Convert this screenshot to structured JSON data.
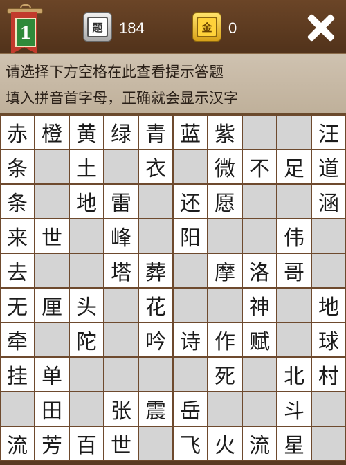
{
  "header": {
    "level_number": "1",
    "question_icon_char": "题",
    "question_count": "184",
    "gold_icon_char": "金",
    "gold_count": "0",
    "close_icon": "close-icon"
  },
  "hint": {
    "line1": "请选择下方空格在此查看提示答题",
    "line2": "填入拼音首字母，正确就会显示汉字"
  },
  "grid": {
    "rows": [
      [
        {
          "t": "赤",
          "s": "f"
        },
        {
          "t": "橙",
          "s": "f"
        },
        {
          "t": "黄",
          "s": "f"
        },
        {
          "t": "绿",
          "s": "f"
        },
        {
          "t": "青",
          "s": "f"
        },
        {
          "t": "蓝",
          "s": "f"
        },
        {
          "t": "紫",
          "s": "f"
        },
        {
          "t": "",
          "s": "b"
        },
        {
          "t": "",
          "s": "b"
        },
        {
          "t": "汪",
          "s": "f"
        }
      ],
      [
        {
          "t": "条",
          "s": "f"
        },
        {
          "t": "",
          "s": "b"
        },
        {
          "t": "土",
          "s": "f"
        },
        {
          "t": "",
          "s": "b"
        },
        {
          "t": "衣",
          "s": "f"
        },
        {
          "t": "",
          "s": "b"
        },
        {
          "t": "微",
          "s": "f"
        },
        {
          "t": "不",
          "s": "f"
        },
        {
          "t": "足",
          "s": "f"
        },
        {
          "t": "道",
          "s": "f"
        }
      ],
      [
        {
          "t": "条",
          "s": "f"
        },
        {
          "t": "",
          "s": "b"
        },
        {
          "t": "地",
          "s": "f"
        },
        {
          "t": "雷",
          "s": "f"
        },
        {
          "t": "",
          "s": "b"
        },
        {
          "t": "还",
          "s": "f"
        },
        {
          "t": "愿",
          "s": "f"
        },
        {
          "t": "",
          "s": "b"
        },
        {
          "t": "",
          "s": "b"
        },
        {
          "t": "涵",
          "s": "f"
        }
      ],
      [
        {
          "t": "来",
          "s": "f"
        },
        {
          "t": "世",
          "s": "f"
        },
        {
          "t": "",
          "s": "b"
        },
        {
          "t": "峰",
          "s": "f"
        },
        {
          "t": "",
          "s": "b"
        },
        {
          "t": "阳",
          "s": "f"
        },
        {
          "t": "",
          "s": "b"
        },
        {
          "t": "",
          "s": "b"
        },
        {
          "t": "伟",
          "s": "f"
        },
        {
          "t": "",
          "s": "b"
        }
      ],
      [
        {
          "t": "去",
          "s": "f"
        },
        {
          "t": "",
          "s": "b"
        },
        {
          "t": "",
          "s": "b"
        },
        {
          "t": "塔",
          "s": "f"
        },
        {
          "t": "葬",
          "s": "f"
        },
        {
          "t": "",
          "s": "b"
        },
        {
          "t": "摩",
          "s": "f"
        },
        {
          "t": "洛",
          "s": "f"
        },
        {
          "t": "哥",
          "s": "f"
        },
        {
          "t": "",
          "s": "b"
        }
      ],
      [
        {
          "t": "无",
          "s": "f"
        },
        {
          "t": "厘",
          "s": "f"
        },
        {
          "t": "头",
          "s": "f"
        },
        {
          "t": "",
          "s": "b"
        },
        {
          "t": "花",
          "s": "f"
        },
        {
          "t": "",
          "s": "b"
        },
        {
          "t": "",
          "s": "b"
        },
        {
          "t": "神",
          "s": "f"
        },
        {
          "t": "",
          "s": "b"
        },
        {
          "t": "地",
          "s": "f"
        }
      ],
      [
        {
          "t": "牵",
          "s": "f"
        },
        {
          "t": "",
          "s": "b"
        },
        {
          "t": "陀",
          "s": "f"
        },
        {
          "t": "",
          "s": "b"
        },
        {
          "t": "吟",
          "s": "f"
        },
        {
          "t": "诗",
          "s": "f"
        },
        {
          "t": "作",
          "s": "f"
        },
        {
          "t": "赋",
          "s": "f"
        },
        {
          "t": "",
          "s": "b"
        },
        {
          "t": "球",
          "s": "f"
        }
      ],
      [
        {
          "t": "挂",
          "s": "f"
        },
        {
          "t": "单",
          "s": "f"
        },
        {
          "t": "",
          "s": "b"
        },
        {
          "t": "",
          "s": "b"
        },
        {
          "t": "",
          "s": "b"
        },
        {
          "t": "",
          "s": "b"
        },
        {
          "t": "死",
          "s": "f"
        },
        {
          "t": "",
          "s": "b"
        },
        {
          "t": "北",
          "s": "f"
        },
        {
          "t": "村",
          "s": "f"
        }
      ],
      [
        {
          "t": "",
          "s": "b"
        },
        {
          "t": "田",
          "s": "f"
        },
        {
          "t": "",
          "s": "b"
        },
        {
          "t": "张",
          "s": "f"
        },
        {
          "t": "震",
          "s": "f"
        },
        {
          "t": "岳",
          "s": "f"
        },
        {
          "t": "",
          "s": "b"
        },
        {
          "t": "",
          "s": "b"
        },
        {
          "t": "斗",
          "s": "f"
        },
        {
          "t": "",
          "s": "b"
        }
      ],
      [
        {
          "t": "流",
          "s": "f"
        },
        {
          "t": "芳",
          "s": "f"
        },
        {
          "t": "百",
          "s": "f"
        },
        {
          "t": "世",
          "s": "f"
        },
        {
          "t": "",
          "s": "b"
        },
        {
          "t": "飞",
          "s": "f"
        },
        {
          "t": "火",
          "s": "f"
        },
        {
          "t": "流",
          "s": "f"
        },
        {
          "t": "星",
          "s": "f"
        },
        {
          "t": "",
          "s": "b"
        }
      ]
    ]
  }
}
